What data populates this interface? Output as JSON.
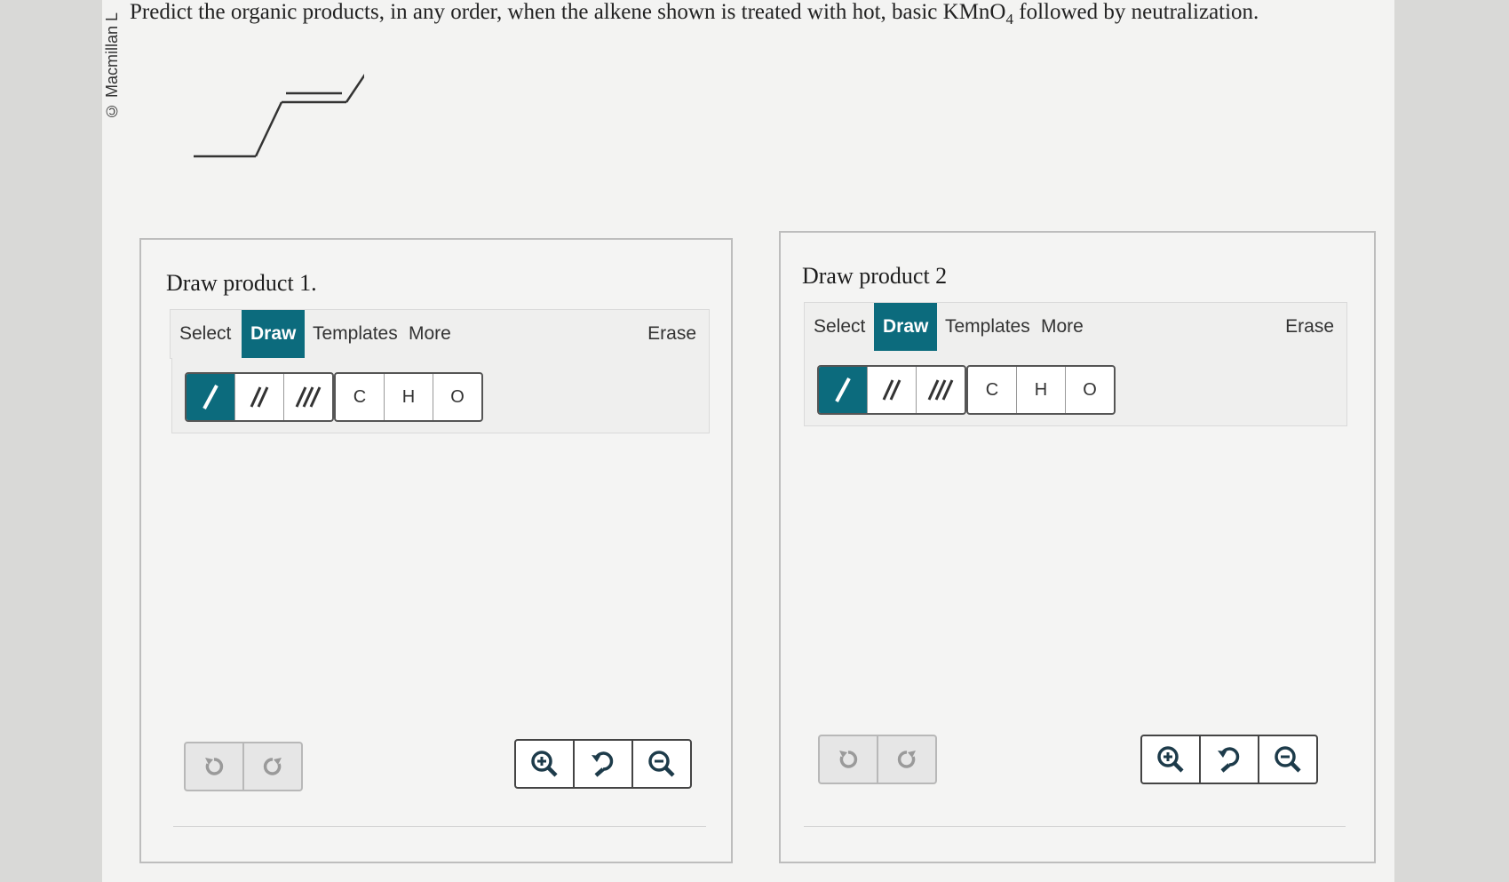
{
  "copyright": "© Macmillan L",
  "question": {
    "text_before": "Predict the organic products, in any order, when the alkene shown is treated with hot, basic KMnO",
    "subscript": "4",
    "text_after": " followed by neutralization."
  },
  "panels": [
    {
      "title": "Draw product 1.",
      "tabs": [
        "Select",
        "Draw",
        "Templates",
        "More"
      ],
      "active_tab": "Draw",
      "erase": "Erase",
      "atoms": [
        "C",
        "H",
        "O"
      ]
    },
    {
      "title": "Draw product 2",
      "tabs": [
        "Select",
        "Draw",
        "Templates",
        "More"
      ],
      "active_tab": "Draw",
      "erase": "Erase",
      "atoms": [
        "C",
        "H",
        "O"
      ]
    }
  ],
  "colors": {
    "accent": "#0c6b7d"
  },
  "icons": [
    "single-bond-icon",
    "double-bond-icon",
    "triple-bond-icon",
    "undo-icon",
    "redo-icon",
    "zoom-in-icon",
    "zoom-reset-icon",
    "zoom-out-icon"
  ]
}
